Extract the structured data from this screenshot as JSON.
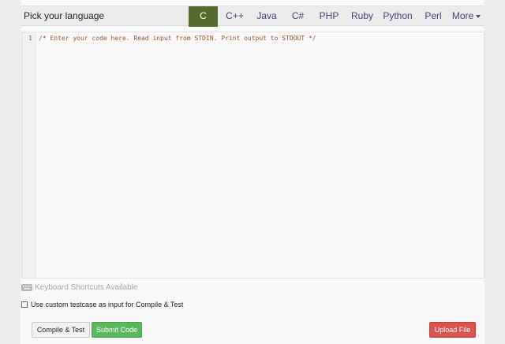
{
  "header": {
    "title": "Pick your language"
  },
  "languages": [
    {
      "label": "C",
      "active": true
    },
    {
      "label": "C++"
    },
    {
      "label": "Java"
    },
    {
      "label": "C#"
    },
    {
      "label": "PHP"
    },
    {
      "label": "Ruby"
    },
    {
      "label": "Python"
    },
    {
      "label": "Perl"
    },
    {
      "label": "More",
      "icon": "chevron-down-icon"
    }
  ],
  "editor": {
    "line_number": "1",
    "code": "/* Enter your code here. Read input from STDIN. Print output to STDOUT */"
  },
  "shortcuts": {
    "icon": "keyboard-icon",
    "label": "Keyboard Shortcuts Available"
  },
  "custom_testcase": {
    "checked": false,
    "label": "Use custom testcase as input for Compile & Test"
  },
  "buttons": {
    "compile": "Compile & Test",
    "submit": "Submit Code",
    "upload": "Upload File"
  },
  "colors": {
    "active_tab": "#556b2f",
    "tab_text": "#4d3a78",
    "submit": "#5cb85c",
    "upload": "#d9534f"
  }
}
